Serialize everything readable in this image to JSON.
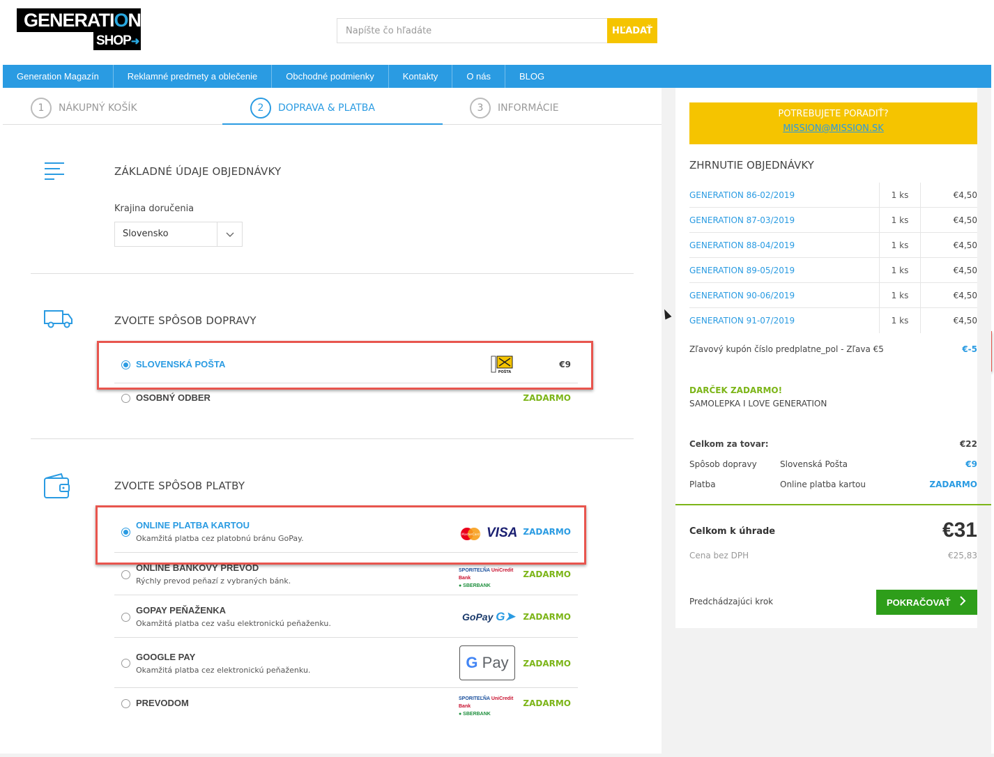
{
  "header": {
    "logo_top": "GENERATI",
    "logo_o": "O",
    "logo_n": "N",
    "logo_bottom": "SHOP",
    "search_placeholder": "Napíšte čo hľadáte",
    "search_button": "HĽADAŤ"
  },
  "nav": [
    "Generation Magazín",
    "Reklamné predmety a oblečenie",
    "Obchodné podmienky",
    "Kontakty",
    "O nás",
    "BLOG"
  ],
  "steps": [
    {
      "num": "1",
      "label": "NÁKUPNÝ KOŠÍK"
    },
    {
      "num": "2",
      "label": "DOPRAVA & PLATBA"
    },
    {
      "num": "3",
      "label": "INFORMÁCIE"
    }
  ],
  "basic": {
    "title": "ZÁKLADNÉ ÚDAJE OBJEDNÁVKY",
    "country_label": "Krajina doručenia",
    "country_value": "Slovensko"
  },
  "shipping": {
    "title": "ZVOĽTE SPÔSOB DOPRAVY",
    "options": [
      {
        "name": "SLOVENSKÁ POŠTA",
        "price": "€9",
        "logo": "Slovenská POŠTA",
        "selected": true
      },
      {
        "name": "OSOBNÝ ODBER",
        "price": "ZADARMO",
        "selected": false
      }
    ]
  },
  "payment": {
    "title": "ZVOĽTE SPÔSOB PLATBY",
    "options": [
      {
        "name": "ONLINE PLATBA KARTOU",
        "desc": "Okamžitá platba cez platobnú bránu GoPay.",
        "price": "ZADARMO",
        "selected": true,
        "logos": [
          "MasterCard",
          "VISA"
        ]
      },
      {
        "name": "ONLINE BANKOVÝ PREVOD",
        "desc": "Rýchly prevod peňazí z vybraných bánk.",
        "price": "ZADARMO",
        "selected": false,
        "logos": [
          "SLOVENSKÁ SPORITEĽŇA",
          "UniCredit Bank",
          "SBERBANK"
        ]
      },
      {
        "name": "GOPAY PEŇAŽENKA",
        "desc": "Okamžitá platba cez vašu elektronickú peňaženku.",
        "price": "ZADARMO",
        "selected": false,
        "logos": [
          "GoPay"
        ]
      },
      {
        "name": "GOOGLE PAY",
        "desc": "Okamžitá platba cez elektronickú peňaženku.",
        "price": "ZADARMO",
        "selected": false,
        "logos": [
          "G Pay"
        ]
      },
      {
        "name": "PREVODOM",
        "desc": "",
        "price": "ZADARMO",
        "selected": false,
        "logos": [
          "SLOVENSKÁ SPORITEĽŇA",
          "UniCredit Bank",
          "SBERBANK"
        ]
      }
    ]
  },
  "sidebar": {
    "help_question": "POTREBUJETE PORADIŤ?",
    "help_email": "MISSION@MISSION.SK",
    "summary_title": "ZHRNUTIE OBJEDNÁVKY",
    "items": [
      {
        "name": "GENERATION 86-02/2019",
        "qty": "1 ks",
        "price": "€4,50"
      },
      {
        "name": "GENERATION 87-03/2019",
        "qty": "1 ks",
        "price": "€4,50"
      },
      {
        "name": "GENERATION 88-04/2019",
        "qty": "1 ks",
        "price": "€4,50"
      },
      {
        "name": "GENERATION 89-05/2019",
        "qty": "1 ks",
        "price": "€4,50"
      },
      {
        "name": "GENERATION 90-06/2019",
        "qty": "1 ks",
        "price": "€4,50"
      },
      {
        "name": "GENERATION 91-07/2019",
        "qty": "1 ks",
        "price": "€4,50"
      }
    ],
    "coupon_label": "Zľavový kupón číslo predplatne_pol - Zľava €5",
    "coupon_value": "€-5",
    "gift_title": "DARČEK ZADARMO!",
    "gift_item": "SAMOLEPKA I LOVE GENERATION",
    "goods_label": "Celkom za tovar:",
    "goods_value": "€22",
    "shipping_label": "Spôsob dopravy",
    "shipping_method": "Slovenská Pošta",
    "shipping_value": "€9",
    "payment_label": "Platba",
    "payment_method": "Online platba kartou",
    "payment_value": "ZADARMO",
    "total_label": "Celkom k úhrade",
    "total_value": "€31",
    "no_vat_label": "Cena bez DPH",
    "no_vat_value": "€25,83",
    "prev_label": "Predchádzajúci krok",
    "continue_label": "POKRAČOVAŤ"
  },
  "colors": {
    "accent": "#2a9be2",
    "yellow": "#f5c400",
    "green": "#7cb518",
    "button_green": "#2e9e1a",
    "highlight": "#e8554e"
  }
}
